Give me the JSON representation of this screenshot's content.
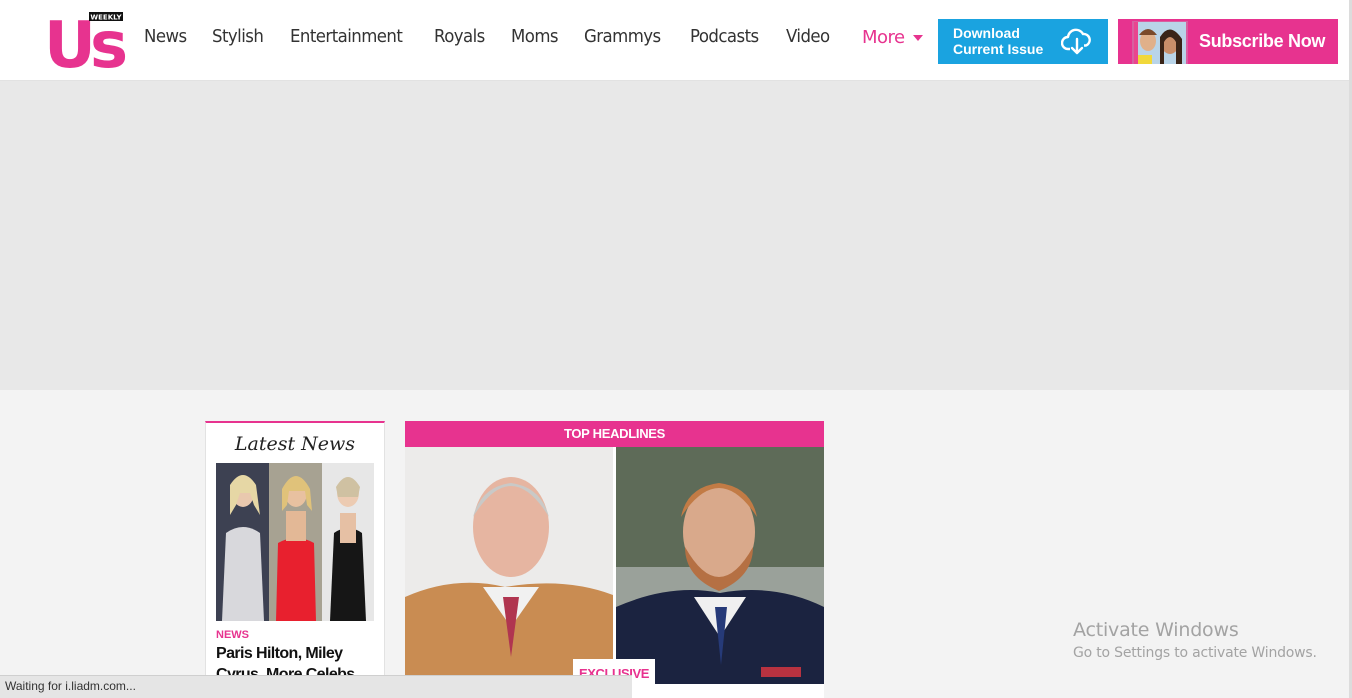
{
  "header": {
    "logo": {
      "text": "Us",
      "badge": "WEEKLY"
    },
    "nav": [
      "News",
      "Stylish",
      "Entertainment",
      "Royals",
      "Moms",
      "Grammys",
      "Podcasts",
      "Video"
    ],
    "more_label": "More",
    "download": {
      "line1": "Download",
      "line2": "Current Issue",
      "icon": "cloud-download-icon"
    },
    "subscribe_label": "Subscribe Now"
  },
  "latest": {
    "title": "Latest News",
    "category": "NEWS",
    "headline": "Paris Hilton, Miley Cyrus, More Celebs"
  },
  "top": {
    "bar_label": "TOP HEADLINES",
    "badge": "EXCLUSIVE"
  },
  "activate": {
    "title": "Activate Windows",
    "subtitle": "Go to Settings to activate Windows."
  },
  "status_text": "Waiting for i.liadm.com...",
  "colors": {
    "brand": "#e7338f",
    "download": "#1aa3e0"
  }
}
